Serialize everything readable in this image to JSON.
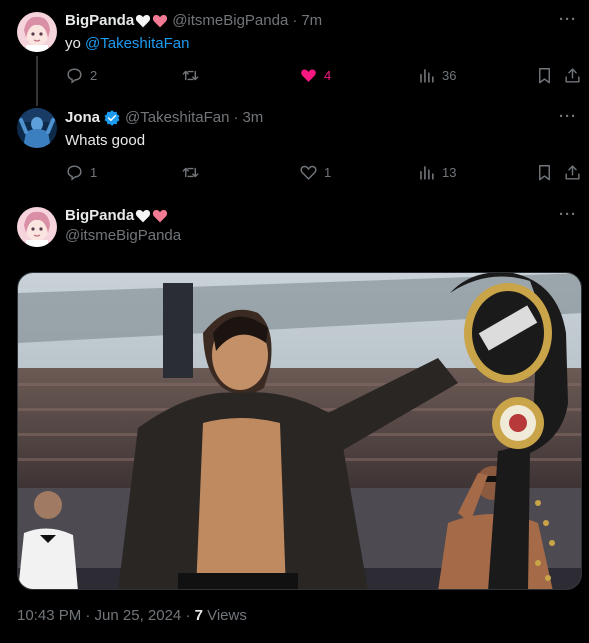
{
  "tweets": [
    {
      "name": "BigPanda",
      "handle": "@itsmeBigPanda",
      "separator": "·",
      "time": "7m",
      "text_prefix": "yo ",
      "mention": "@TakeshitaFan",
      "replies": "2",
      "retweets": "",
      "likes": "4",
      "views": "36",
      "liked": true
    },
    {
      "name": "Jona",
      "handle": "@TakeshitaFan",
      "separator": "·",
      "time": "3m",
      "text": "Whats good",
      "replies": "1",
      "retweets": "",
      "likes": "1",
      "views": "13",
      "verified": true
    }
  ],
  "main_tweet": {
    "name": "BigPanda",
    "handle": "@itsmeBigPanda",
    "footer_time": "10:43 PM · Jun 25, 2024 · ",
    "views_count": "7",
    "views_label": " Views"
  },
  "more_label": "···",
  "colors": {
    "background": "#000000",
    "text": "#e7e9ea",
    "muted": "#71767b",
    "link": "#1d9bf0",
    "like": "#f91880"
  },
  "icons": [
    "white-heart-icon",
    "pink-heart-icon",
    "verified-badge-icon",
    "reply-icon",
    "retweet-icon",
    "like-icon",
    "views-icon",
    "bookmark-icon",
    "share-icon",
    "more-icon"
  ]
}
